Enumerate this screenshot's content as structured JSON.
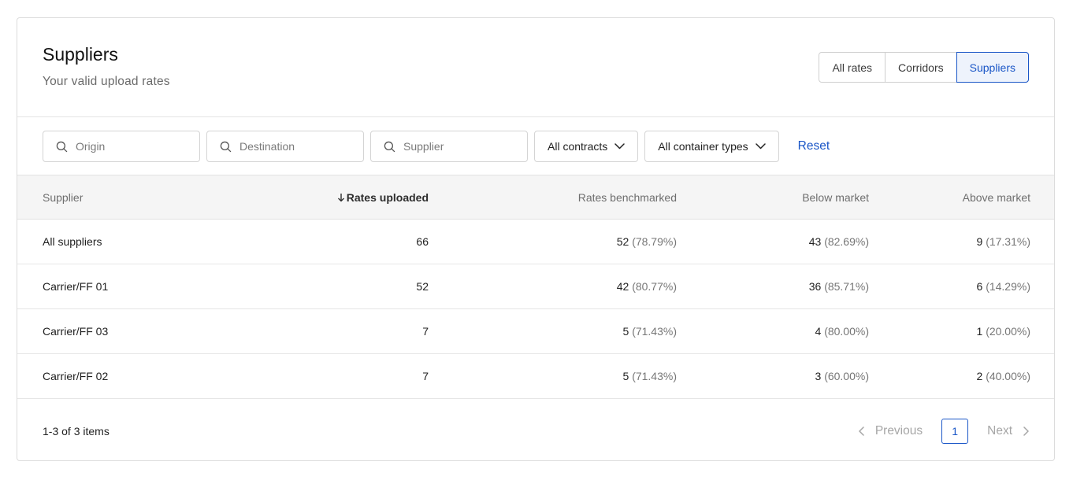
{
  "header": {
    "title": "Suppliers",
    "subtitle": "Your valid upload rates",
    "tabs": [
      {
        "label": "All rates",
        "active": false
      },
      {
        "label": "Corridors",
        "active": false
      },
      {
        "label": "Suppliers",
        "active": true
      }
    ]
  },
  "filters": {
    "origin_placeholder": "Origin",
    "destination_placeholder": "Destination",
    "supplier_placeholder": "Supplier",
    "contracts_label": "All contracts",
    "container_types_label": "All container types",
    "reset_label": "Reset"
  },
  "table": {
    "columns": {
      "supplier": "Supplier",
      "rates_uploaded": "Rates uploaded",
      "rates_benchmarked": "Rates benchmarked",
      "below_market": "Below market",
      "above_market": "Above market"
    },
    "sorted_column": "rates_uploaded",
    "sort_direction": "descending",
    "rows": [
      {
        "supplier": "All suppliers",
        "uploaded": "66",
        "bench": "52",
        "bench_pct": "(78.79%)",
        "below": "43",
        "below_pct": "(82.69%)",
        "above": "9",
        "above_pct": "(17.31%)"
      },
      {
        "supplier": "Carrier/FF 01",
        "uploaded": "52",
        "bench": "42",
        "bench_pct": "(80.77%)",
        "below": "36",
        "below_pct": "(85.71%)",
        "above": "6",
        "above_pct": "(14.29%)"
      },
      {
        "supplier": "Carrier/FF 03",
        "uploaded": "7",
        "bench": "5",
        "bench_pct": "(71.43%)",
        "below": "4",
        "below_pct": "(80.00%)",
        "above": "1",
        "above_pct": "(20.00%)"
      },
      {
        "supplier": "Carrier/FF 02",
        "uploaded": "7",
        "bench": "5",
        "bench_pct": "(71.43%)",
        "below": "3",
        "below_pct": "(60.00%)",
        "above": "2",
        "above_pct": "(40.00%)"
      }
    ]
  },
  "footer": {
    "item_count": "1-3 of 3 items",
    "previous_label": "Previous",
    "current_page": "1",
    "next_label": "Next"
  },
  "colors": {
    "accent": "#1a56c7",
    "header_row_bg": "#f5f5f5",
    "muted_text": "#767676"
  },
  "icons": {
    "search": "search-icon",
    "dropdown": "chevron-down-icon",
    "sort": "arrow-down-icon",
    "prev": "chevron-left-icon",
    "next": "chevron-right-icon"
  }
}
